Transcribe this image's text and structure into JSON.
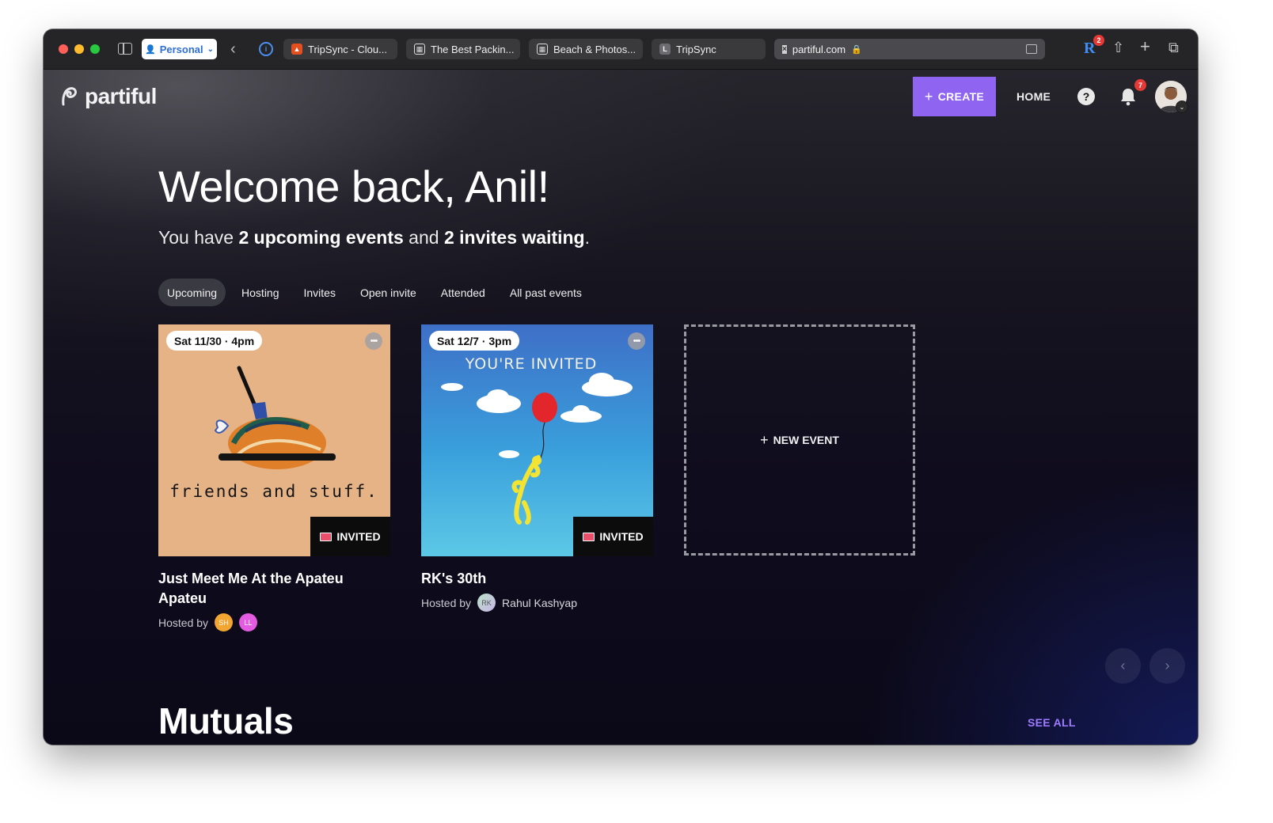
{
  "browser": {
    "profile_label": "Personal",
    "tabs": [
      {
        "label": "TripSync - Clou..."
      },
      {
        "label": "The Best Packin..."
      },
      {
        "label": "Beach & Photos..."
      },
      {
        "label": "TripSync"
      }
    ],
    "url": "partiful.com",
    "extension_badge": "2"
  },
  "header": {
    "logo_text": "partiful",
    "create_label": "CREATE",
    "home_label": "HOME",
    "help_label": "?",
    "notification_count": "7"
  },
  "welcome": {
    "title": "Welcome back, Anil!",
    "prefix": "You have ",
    "upcoming": "2 upcoming events",
    "middle": " and ",
    "invites": "2 invites waiting",
    "suffix": "."
  },
  "filters": [
    "Upcoming",
    "Hosting",
    "Invites",
    "Open invite",
    "Attended",
    "All past events"
  ],
  "active_filter": "Upcoming",
  "events": [
    {
      "date": "Sat 11/30 · 4pm",
      "status": "INVITED",
      "title": "Just Meet Me At the Apateu Apateu",
      "hosted_by": "Hosted by",
      "hosts": [
        {
          "initials": "SH",
          "color": "#f2a531"
        },
        {
          "initials": "LL",
          "color": "#e25be0"
        }
      ],
      "art_text": "friends and stuff.",
      "art_bg": "#e6b387"
    },
    {
      "date": "Sat 12/7 · 3pm",
      "status": "INVITED",
      "title": "RK's 30th",
      "hosted_by": "Hosted by",
      "host_name": "Rahul Kashyap",
      "host_initials": "RK",
      "art_text": "YOU'RE INVITED",
      "art_bg": "#3aa7dc"
    }
  ],
  "new_event_label": "NEW EVENT",
  "mutuals": {
    "title": "Mutuals",
    "see_all": "SEE ALL"
  },
  "colors": {
    "accent": "#8e64f1",
    "link": "#9e7bff",
    "badge": "#e53935"
  }
}
